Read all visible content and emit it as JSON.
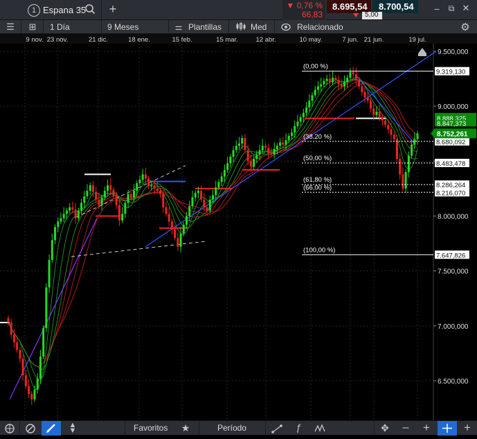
{
  "header": {
    "instrument_index": "1",
    "instrument": "Espana 35",
    "change_pct": "▼ 0,76 %",
    "change_abs": "66,83",
    "sell_price": "8.695,54",
    "buy_price": "8.700,54",
    "spread": "5,00"
  },
  "toolbar": {
    "interval": "1 Día",
    "range": "9 Meses",
    "templates": "Plantillas",
    "price_type": "Med",
    "related": "Relacionado"
  },
  "bottom": {
    "favorites": "Favoritos",
    "period": "Período"
  },
  "colors": {
    "background": "#000000",
    "bull": "#22dd22",
    "bear": "#ee2222",
    "trendline_blue": "#3355ff",
    "trendline_purple": "#8833ff",
    "current_price_tag": "#0a8a0a"
  },
  "chart_data": {
    "type": "candlestick",
    "title": "",
    "x_dates": [
      "9 nov.",
      "23 nov.",
      "21 dic.",
      "18 ene.",
      "15 feb.",
      "15 mar.",
      "12 abr.",
      "10 may.",
      "7 jun.",
      "21 jun.",
      "19 jul."
    ],
    "y_ticks": [
      "9.500,000",
      "9.000,000",
      "8.500,000",
      "8.000,000",
      "7.500,000",
      "7.000,000",
      "6.500,000"
    ],
    "ylim": [
      6200,
      9550
    ],
    "close_series": [
      7030,
      6920,
      6850,
      6780,
      6700,
      6550,
      6450,
      6380,
      6330,
      6420,
      6520,
      6720,
      6980,
      7350,
      7600,
      7780,
      7900,
      7950,
      7980,
      8020,
      8050,
      8080,
      8060,
      7980,
      8050,
      8120,
      8180,
      8230,
      8280,
      8220,
      8150,
      8100,
      8170,
      8230,
      8280,
      8240,
      8180,
      8100,
      7960,
      8020,
      8120,
      8200,
      8170,
      8230,
      8300,
      8330,
      8380,
      8340,
      8270,
      8280,
      8250,
      8230,
      8200,
      8080,
      8020,
      7950,
      7880,
      7800,
      7720,
      7840,
      7920,
      8000,
      8090,
      8170,
      8210,
      8230,
      8150,
      8080,
      8050,
      8150,
      8190,
      8260,
      8310,
      8360,
      8420,
      8480,
      8540,
      8600,
      8640,
      8660,
      8710,
      8600,
      8500,
      8450,
      8520,
      8560,
      8600,
      8640,
      8620,
      8570,
      8560,
      8610,
      8640,
      8670,
      8650,
      8690,
      8730,
      8760,
      8820,
      8860,
      8900,
      8940,
      8990,
      9050,
      9100,
      9150,
      9180,
      9200,
      9230,
      9250,
      9220,
      9260,
      9240,
      9200,
      9180,
      9220,
      9260,
      9310,
      9290,
      9240,
      9180,
      9130,
      9080,
      9050,
      8980,
      8920,
      8950,
      8900,
      8870,
      8830,
      8790,
      8740,
      8700,
      8520,
      8380,
      8250,
      8400,
      8550,
      8650,
      8700,
      8752.261
    ],
    "moving_averages": [
      "green ribbon",
      "red ribbon"
    ],
    "fibonacci": {
      "labels": [
        "(0,00 %)",
        "(38,20 %)",
        "(50,00 %)",
        "(61,80 %)",
        "(66,00 %)",
        "(100,00 %)"
      ],
      "price_labels": [
        "9.319,130",
        "8.680,092",
        "8.483,478",
        "8.286,264",
        "8.216,070",
        "7.647,826"
      ],
      "values": [
        9319.13,
        8680.092,
        8483.478,
        8286.264,
        8216.07,
        7647.826
      ]
    },
    "price_tags": {
      "current": "8.752,261",
      "overlapped_1": "8.888,325",
      "overlapped_2": "8.847,373"
    }
  }
}
